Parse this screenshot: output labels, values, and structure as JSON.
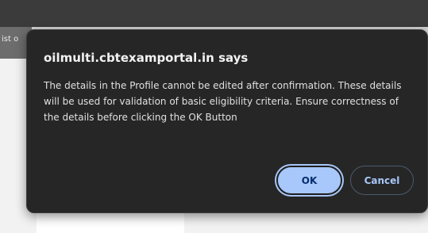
{
  "background": {
    "page_text_fragment": "ist o"
  },
  "dialog": {
    "title": "oilmulti.cbtexamportal.in says",
    "message": "The details in the Profile cannot be edited after confirmation. These details will be used for validation of basic eligibility criteria. Ensure correctness of the details before clicking the OK Button",
    "ok_label": "OK",
    "cancel_label": "Cancel"
  },
  "colors": {
    "dialog_background": "#262626",
    "ok_button": "#a8c7fa",
    "ok_text": "#062e6f",
    "cancel_text": "#a8c7fa",
    "browser_topbar": "#3b3b3b"
  }
}
